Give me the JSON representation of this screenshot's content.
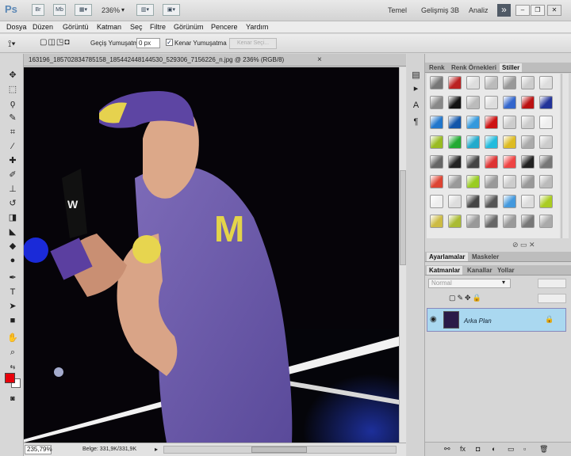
{
  "app": {
    "logo": "Ps",
    "bridge_btn": "Br",
    "mini_bridge_btn": "Mb",
    "zoom": "236%",
    "workspaces": [
      "Temel",
      "Gelişmiş 3B",
      "Analiz"
    ],
    "more_icon": "double-chevron-right-icon"
  },
  "menu": [
    "Dosya",
    "Düzen",
    "Görüntü",
    "Katman",
    "Seç",
    "Filtre",
    "Görünüm",
    "Pencere",
    "Yardım"
  ],
  "options": {
    "feather_label": "Geçiş Yumuşatma:",
    "feather_value": "0 px",
    "antialias_label": "Kenar Yumuşatma",
    "antialias_checked": "✓",
    "refine_button": "Kenar Seçi..."
  },
  "document": {
    "tab_title": "163196_185702834785158_185442448144530_529306_7156226_n.jpg @ 236% (RGB/8)",
    "close": "×",
    "status_zoom": "235,79%",
    "status_doc": "Belge: 331,9K/331,9K"
  },
  "panels": {
    "top_tabs": [
      "Renk",
      "Renk Örnekleri",
      "Stiller"
    ],
    "adjust_tabs": [
      "Ayarlamalar",
      "Maskeler"
    ],
    "layer_tabs": [
      "Katmanlar",
      "Kanallar",
      "Yollar"
    ],
    "blend_mode": "Normal",
    "layer_name": "Arka Plan"
  },
  "colors": {
    "foreground": "#e8000a",
    "background": "#ffffff",
    "layer_selected": "#aad8f0"
  }
}
